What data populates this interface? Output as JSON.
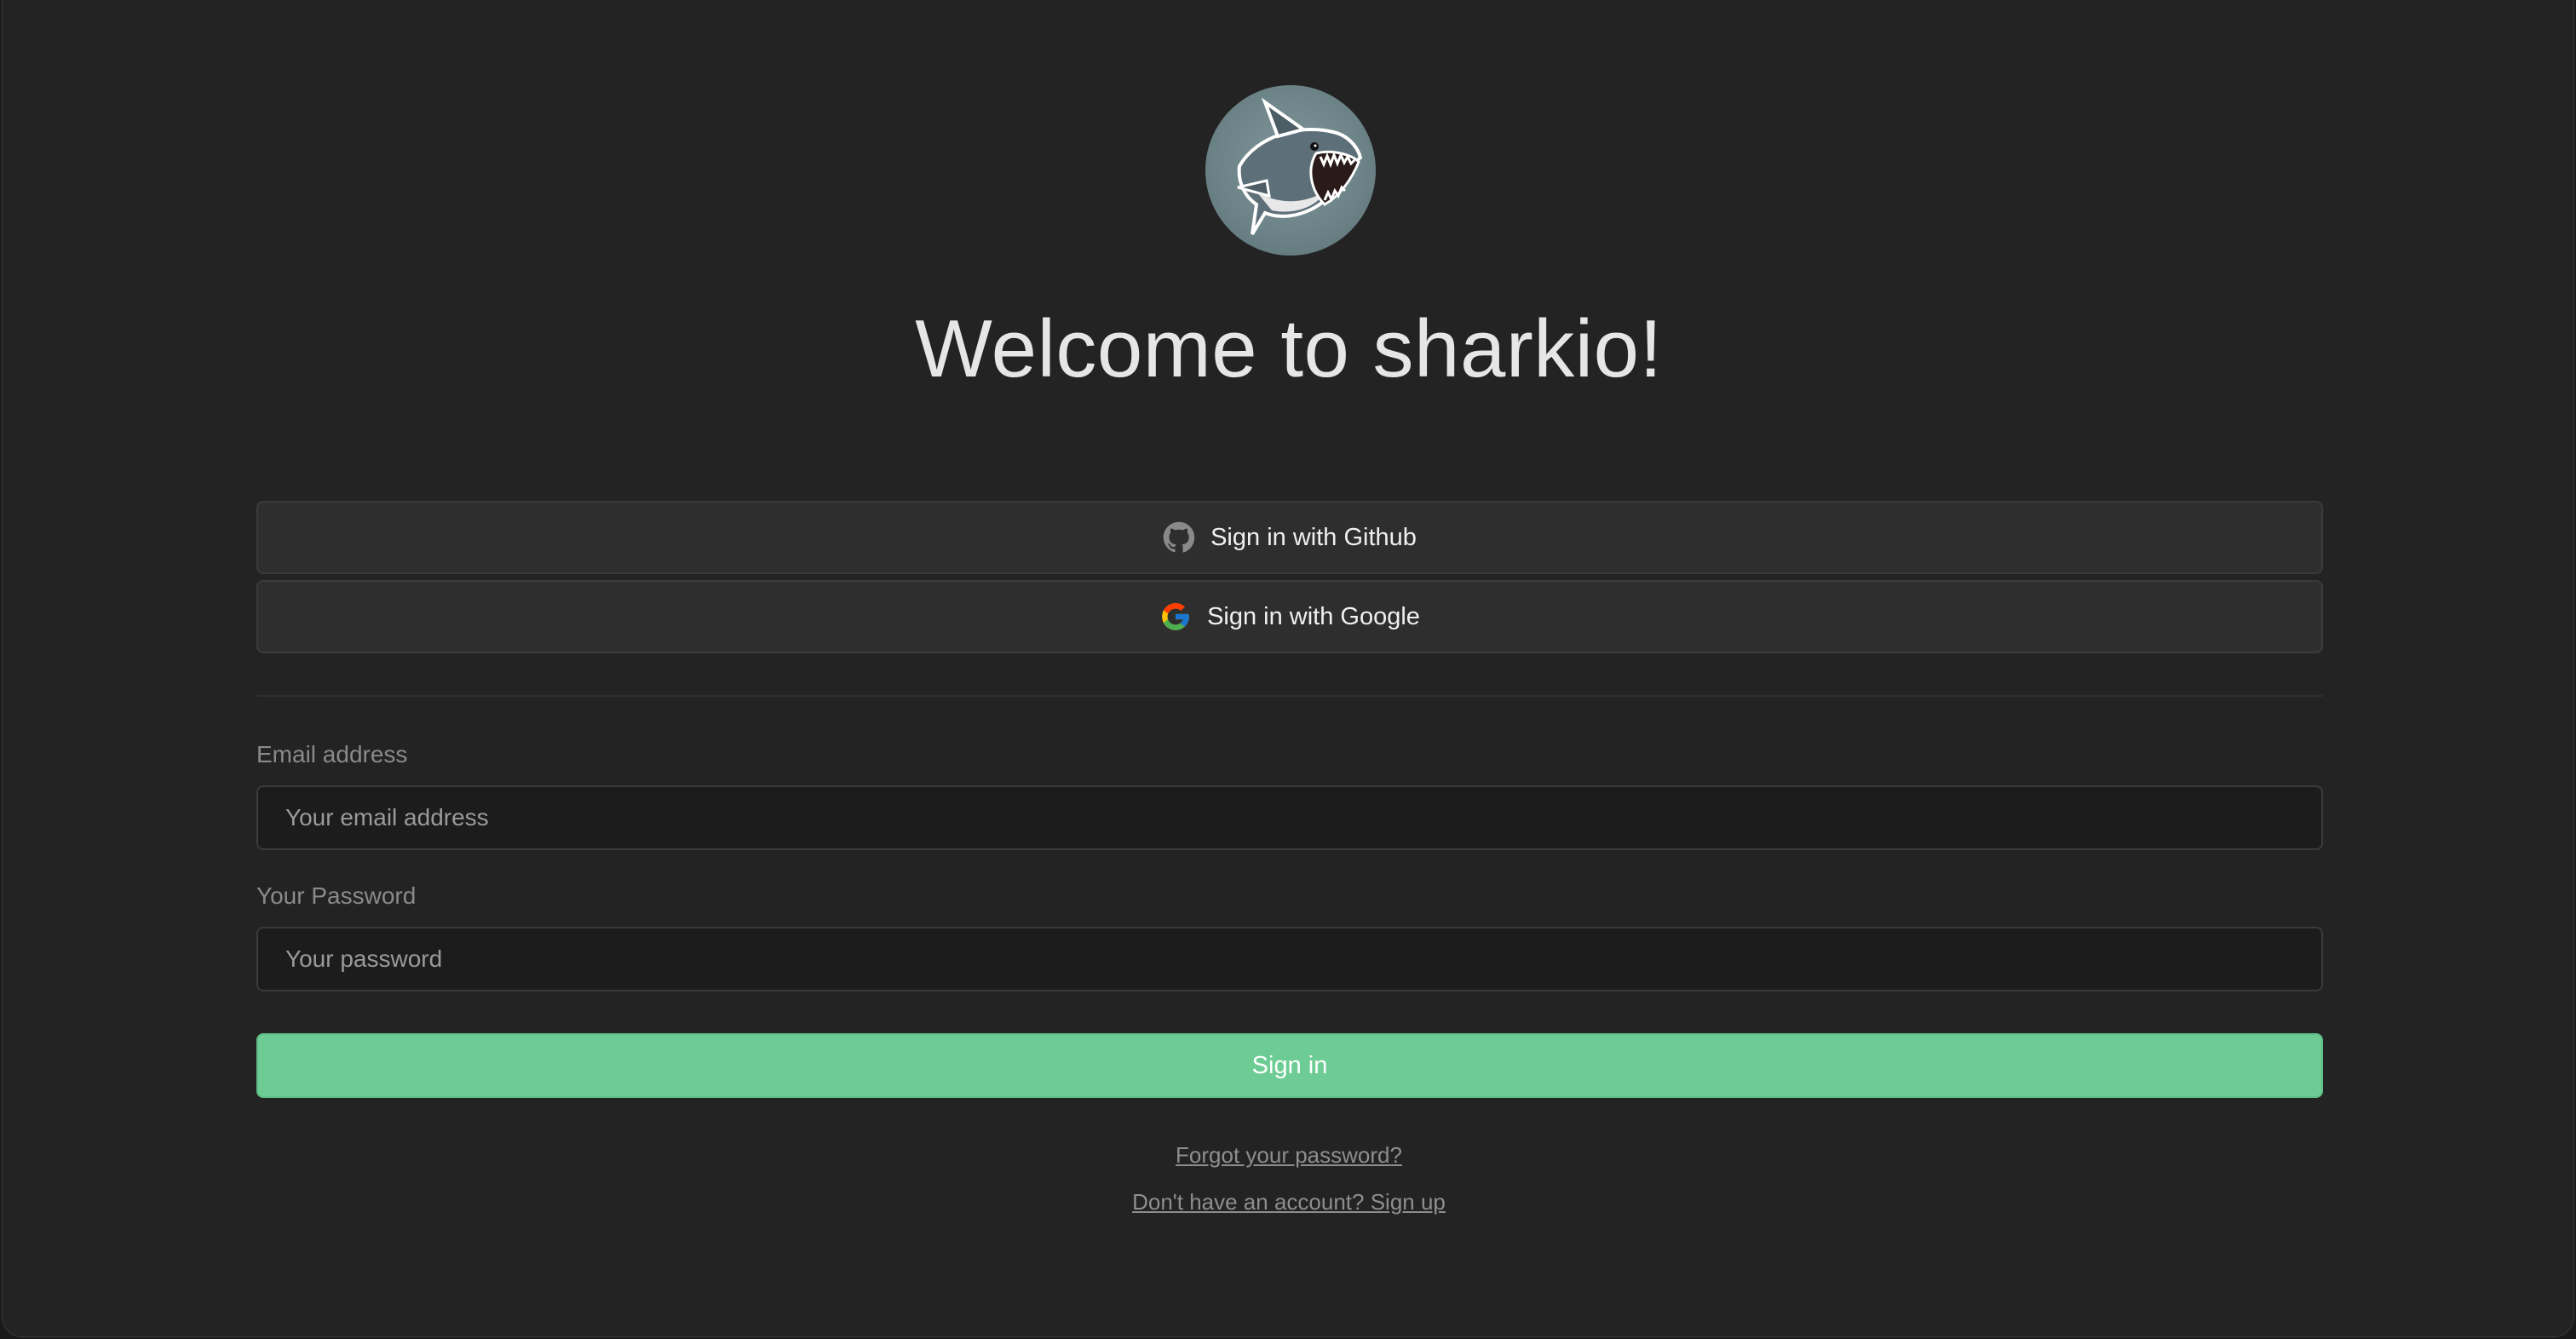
{
  "brand": {
    "logo_icon": "shark-logo-icon",
    "title": "Welcome to sharkio!"
  },
  "auth": {
    "github_label": "Sign in with Github",
    "github_icon": "github-icon",
    "google_label": "Sign in with Google",
    "google_icon": "google-icon"
  },
  "form": {
    "email_label": "Email address",
    "email_placeholder": "Your email address",
    "email_value": "",
    "password_label": "Your Password",
    "password_placeholder": "Your password",
    "password_value": "",
    "submit_label": "Sign in"
  },
  "links": {
    "forgot": "Forgot your password?",
    "signup": "Don't have an account? Sign up"
  },
  "colors": {
    "background": "#232323",
    "accent": "#6ccc94",
    "button_bg": "#2e2e2e",
    "input_bg": "#1c1c1c",
    "text": "#e6e6e6"
  }
}
